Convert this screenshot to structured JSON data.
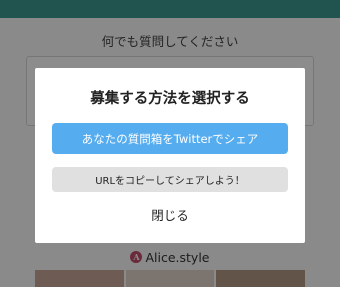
{
  "background": {
    "prompt": "何でも質問してください",
    "brand": {
      "mark": "A",
      "name": "Alice.style"
    }
  },
  "modal": {
    "title": "募集する方法を選択する",
    "twitter_button": "あなたの質問箱をTwitterでシェア",
    "copy_button": "URLをコピーしてシェアしよう！",
    "close": "閉じる"
  },
  "colors": {
    "top_bar": "#3f9a91",
    "twitter": "#55acee",
    "copy_button": "#e0e0e0",
    "brand_mark": "#c44b6e"
  }
}
